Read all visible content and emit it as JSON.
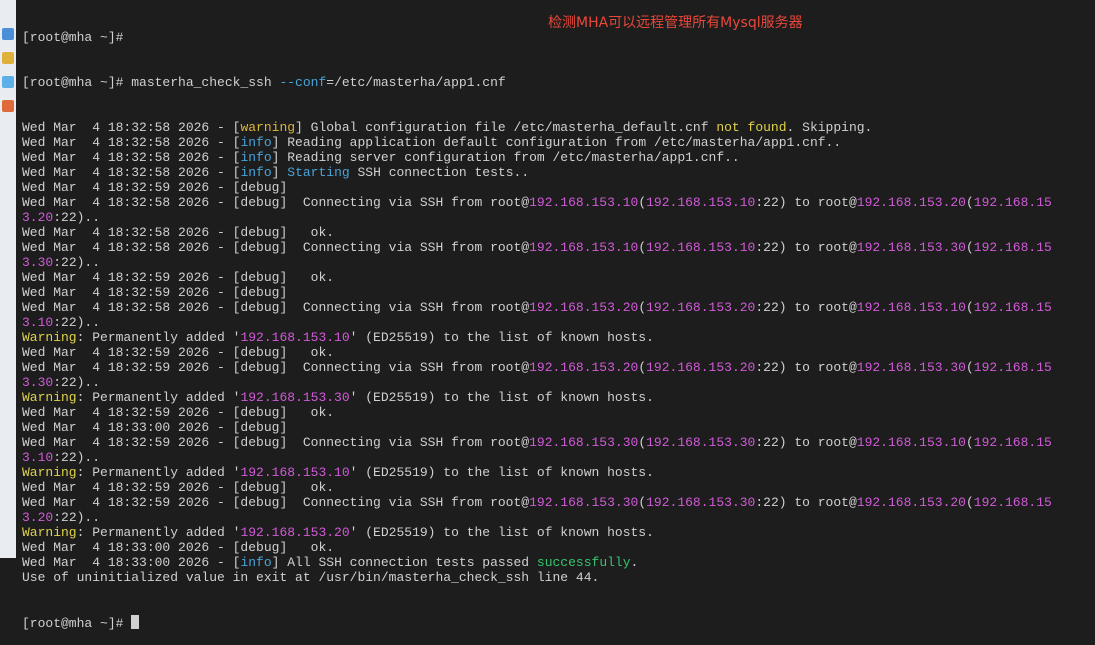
{
  "annotation": "检测MHA可以远程管理所有Mysql服务器",
  "colors": {
    "background": "#1d1d1d",
    "text": "#d0d0d0",
    "info": "#4aa3d8",
    "warning": "#d9b63d",
    "ip": "#d25ad9",
    "success": "#37c46e",
    "annotation": "#e8483a"
  },
  "terminal": {
    "line1": "[root@mha ~]#",
    "cmd_prompt": "[root@mha ~]# ",
    "cmd_name": "masterha_check_ssh ",
    "cmd_opt": "--conf",
    "cmd_arg": "=/etc/masterha/app1.cnf",
    "final_prompt": "[root@mha ~]# ",
    "lines": [
      {
        "parts": [
          {
            "t": "Wed Mar  4 18:32:58 2026 - ["
          },
          {
            "t": "warning",
            "c": "warnkw"
          },
          {
            "t": "] Global configuration file /etc/masterha_default.cnf "
          },
          {
            "t": "not found",
            "c": "yellow"
          },
          {
            "t": ". Skipping."
          }
        ]
      },
      {
        "parts": [
          {
            "t": "Wed Mar  4 18:32:58 2026 - ["
          },
          {
            "t": "info",
            "c": "info"
          },
          {
            "t": "] Reading application default configuration from /etc/masterha/app1.cnf.."
          }
        ]
      },
      {
        "parts": [
          {
            "t": "Wed Mar  4 18:32:58 2026 - ["
          },
          {
            "t": "info",
            "c": "info"
          },
          {
            "t": "] Reading server configuration from /etc/masterha/app1.cnf.."
          }
        ]
      },
      {
        "parts": [
          {
            "t": "Wed Mar  4 18:32:58 2026 - ["
          },
          {
            "t": "info",
            "c": "info"
          },
          {
            "t": "] "
          },
          {
            "t": "Starting",
            "c": "info"
          },
          {
            "t": " SSH connection tests.."
          }
        ]
      },
      {
        "parts": [
          {
            "t": "Wed Mar  4 18:32:59 2026 - [debug]"
          }
        ]
      },
      {
        "parts": [
          {
            "t": "Wed Mar  4 18:32:58 2026 - [debug]  Connecting via SSH from root@"
          },
          {
            "t": "192.168.153.10",
            "c": "ip"
          },
          {
            "t": "("
          },
          {
            "t": "192.168.153.10",
            "c": "ip"
          },
          {
            "t": ":22) to root@"
          },
          {
            "t": "192.168.153.20",
            "c": "ip"
          },
          {
            "t": "("
          },
          {
            "t": "192.168.15",
            "c": "ip"
          }
        ]
      },
      {
        "parts": [
          {
            "t": "3.20",
            "c": "ip"
          },
          {
            "t": ":22).."
          }
        ]
      },
      {
        "parts": [
          {
            "t": "Wed Mar  4 18:32:58 2026 - [debug]   ok."
          }
        ]
      },
      {
        "parts": [
          {
            "t": "Wed Mar  4 18:32:58 2026 - [debug]  Connecting via SSH from root@"
          },
          {
            "t": "192.168.153.10",
            "c": "ip"
          },
          {
            "t": "("
          },
          {
            "t": "192.168.153.10",
            "c": "ip"
          },
          {
            "t": ":22) to root@"
          },
          {
            "t": "192.168.153.30",
            "c": "ip"
          },
          {
            "t": "("
          },
          {
            "t": "192.168.15",
            "c": "ip"
          }
        ]
      },
      {
        "parts": [
          {
            "t": "3.30",
            "c": "ip"
          },
          {
            "t": ":22).."
          }
        ]
      },
      {
        "parts": [
          {
            "t": "Wed Mar  4 18:32:59 2026 - [debug]   ok."
          }
        ]
      },
      {
        "parts": [
          {
            "t": "Wed Mar  4 18:32:59 2026 - [debug]"
          }
        ]
      },
      {
        "parts": [
          {
            "t": "Wed Mar  4 18:32:58 2026 - [debug]  Connecting via SSH from root@"
          },
          {
            "t": "192.168.153.20",
            "c": "ip"
          },
          {
            "t": "("
          },
          {
            "t": "192.168.153.20",
            "c": "ip"
          },
          {
            "t": ":22) to root@"
          },
          {
            "t": "192.168.153.10",
            "c": "ip"
          },
          {
            "t": "("
          },
          {
            "t": "192.168.15",
            "c": "ip"
          }
        ]
      },
      {
        "parts": [
          {
            "t": "3.10",
            "c": "ip"
          },
          {
            "t": ":22).."
          }
        ]
      },
      {
        "parts": [
          {
            "t": "Warning",
            "c": "yellow"
          },
          {
            "t": ": Permanently added '"
          },
          {
            "t": "192.168.153.10",
            "c": "ip"
          },
          {
            "t": "' (ED25519) to the list of known hosts."
          }
        ]
      },
      {
        "parts": [
          {
            "t": "Wed Mar  4 18:32:59 2026 - [debug]   ok."
          }
        ]
      },
      {
        "parts": [
          {
            "t": "Wed Mar  4 18:32:59 2026 - [debug]  Connecting via SSH from root@"
          },
          {
            "t": "192.168.153.20",
            "c": "ip"
          },
          {
            "t": "("
          },
          {
            "t": "192.168.153.20",
            "c": "ip"
          },
          {
            "t": ":22) to root@"
          },
          {
            "t": "192.168.153.30",
            "c": "ip"
          },
          {
            "t": "("
          },
          {
            "t": "192.168.15",
            "c": "ip"
          }
        ]
      },
      {
        "parts": [
          {
            "t": "3.30",
            "c": "ip"
          },
          {
            "t": ":22).."
          }
        ]
      },
      {
        "parts": [
          {
            "t": "Warning",
            "c": "yellow"
          },
          {
            "t": ": Permanently added '"
          },
          {
            "t": "192.168.153.30",
            "c": "ip"
          },
          {
            "t": "' (ED25519) to the list of known hosts."
          }
        ]
      },
      {
        "parts": [
          {
            "t": "Wed Mar  4 18:32:59 2026 - [debug]   ok."
          }
        ]
      },
      {
        "parts": [
          {
            "t": "Wed Mar  4 18:33:00 2026 - [debug]"
          }
        ]
      },
      {
        "parts": [
          {
            "t": "Wed Mar  4 18:32:59 2026 - [debug]  Connecting via SSH from root@"
          },
          {
            "t": "192.168.153.30",
            "c": "ip"
          },
          {
            "t": "("
          },
          {
            "t": "192.168.153.30",
            "c": "ip"
          },
          {
            "t": ":22) to root@"
          },
          {
            "t": "192.168.153.10",
            "c": "ip"
          },
          {
            "t": "("
          },
          {
            "t": "192.168.15",
            "c": "ip"
          }
        ]
      },
      {
        "parts": [
          {
            "t": "3.10",
            "c": "ip"
          },
          {
            "t": ":22).."
          }
        ]
      },
      {
        "parts": [
          {
            "t": "Warning",
            "c": "yellow"
          },
          {
            "t": ": Permanently added '"
          },
          {
            "t": "192.168.153.10",
            "c": "ip"
          },
          {
            "t": "' (ED25519) to the list of known hosts."
          }
        ]
      },
      {
        "parts": [
          {
            "t": "Wed Mar  4 18:32:59 2026 - [debug]   ok."
          }
        ]
      },
      {
        "parts": [
          {
            "t": "Wed Mar  4 18:32:59 2026 - [debug]  Connecting via SSH from root@"
          },
          {
            "t": "192.168.153.30",
            "c": "ip"
          },
          {
            "t": "("
          },
          {
            "t": "192.168.153.30",
            "c": "ip"
          },
          {
            "t": ":22) to root@"
          },
          {
            "t": "192.168.153.20",
            "c": "ip"
          },
          {
            "t": "("
          },
          {
            "t": "192.168.15",
            "c": "ip"
          }
        ]
      },
      {
        "parts": [
          {
            "t": "3.20",
            "c": "ip"
          },
          {
            "t": ":22).."
          }
        ]
      },
      {
        "parts": [
          {
            "t": "Warning",
            "c": "yellow"
          },
          {
            "t": ": Permanently added '"
          },
          {
            "t": "192.168.153.20",
            "c": "ip"
          },
          {
            "t": "' (ED25519) to the list of known hosts."
          }
        ]
      },
      {
        "parts": [
          {
            "t": "Wed Mar  4 18:33:00 2026 - [debug]   ok."
          }
        ]
      },
      {
        "parts": [
          {
            "t": "Wed Mar  4 18:33:00 2026 - ["
          },
          {
            "t": "info",
            "c": "info"
          },
          {
            "t": "] All SSH connection tests passed "
          },
          {
            "t": "successfully",
            "c": "green"
          },
          {
            "t": "."
          }
        ]
      },
      {
        "parts": [
          {
            "t": "Use of uninitialized value in exit at /usr/bin/masterha_check_ssh line 44."
          }
        ]
      }
    ]
  }
}
